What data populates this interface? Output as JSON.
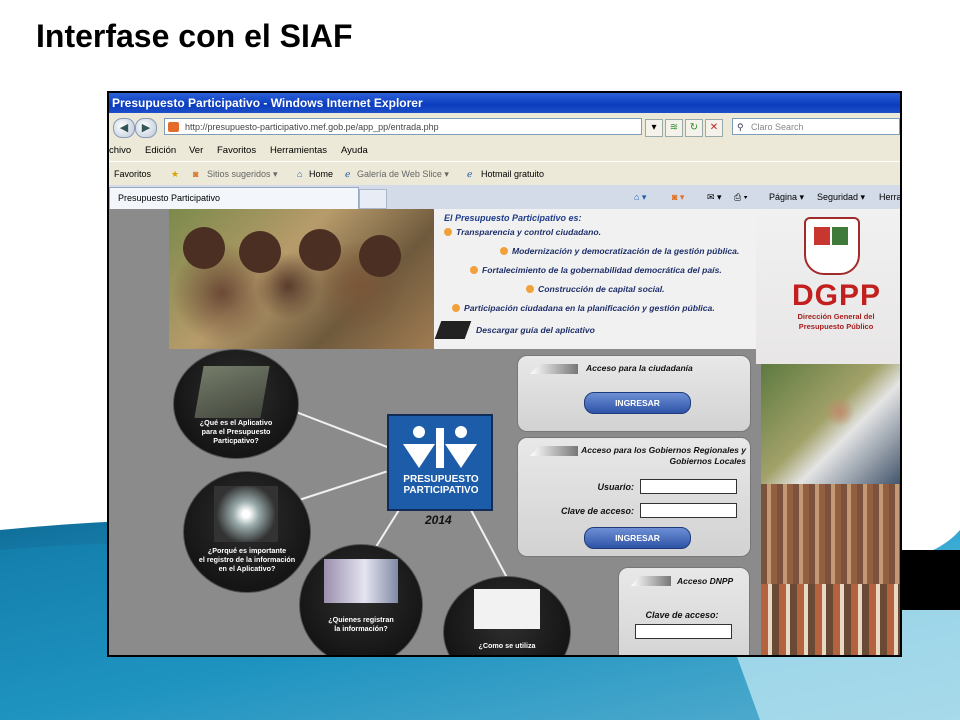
{
  "slide": {
    "title": "Interfase con el SIAF"
  },
  "browser": {
    "window_title": "Presupuesto Participativo - Windows Internet Explorer",
    "address": "http://presupuesto-participativo.mef.gob.pe/app_pp/entrada.php",
    "search_placeholder": "Claro Search",
    "menu": [
      "chivo",
      "Edición",
      "Ver",
      "Favoritos",
      "Herramientas",
      "Ayuda"
    ],
    "favorites_label": "Favoritos",
    "fav_links": [
      "Sitios sugeridos ▾",
      "Home",
      "Galería de Web Slice ▾",
      "Hotmail gratuito"
    ],
    "tab_label": "Presupuesto Participativo",
    "commands": [
      "Página ▾",
      "Seguridad ▾",
      "Herra"
    ]
  },
  "page": {
    "intro_title": "El Presupuesto Participativo es:",
    "bullets": [
      "Transparencia y control ciudadano.",
      "Modernización y democratización de la gestión pública.",
      "Fortalecimiento de la gobernabilidad democrática del país.",
      "Construcción de capital social.",
      "Participación ciudadana en la planificación y gestión pública."
    ],
    "download_label": "Descargar guía del aplicativo",
    "org": {
      "acronym": "DGPP",
      "name_line1": "Dirección General del",
      "name_line2": "Presupuesto Público"
    },
    "hub": {
      "line1": "PRESUPUESTO",
      "line2": "PARTICIPATIVO",
      "year": "2014"
    },
    "bubbles": [
      {
        "lines": [
          "¿Qué es el Aplicativo",
          "para el Presupuesto",
          "Particpativo?"
        ]
      },
      {
        "lines": [
          "¿Porqué es importante",
          "el registro de la información",
          "en el Aplicativo?"
        ]
      },
      {
        "lines": [
          "¿Quienes registran",
          "la información?"
        ]
      },
      {
        "lines": [
          "¿Como se utiliza"
        ]
      }
    ],
    "citizen": {
      "title": "Acceso para la ciudadanía",
      "button": "INGRESAR"
    },
    "gov": {
      "title_line1": "Acceso para los Gobiernos Regionales y",
      "title_line2": "Gobiernos Locales",
      "user_label": "Usuario:",
      "user_value": "",
      "pass_label": "Clave de acceso:",
      "pass_value": "",
      "button": "INGRESAR"
    },
    "dnpp": {
      "title": "Acceso DNPP",
      "pass_label": "Clave de acceso:",
      "pass_value": ""
    }
  },
  "colors": {
    "accent_blue": "#1d5ca8",
    "bullet_orange": "#f0a13a",
    "dgpp_red": "#c21f1f",
    "slide_teal": "#1e8db8"
  }
}
